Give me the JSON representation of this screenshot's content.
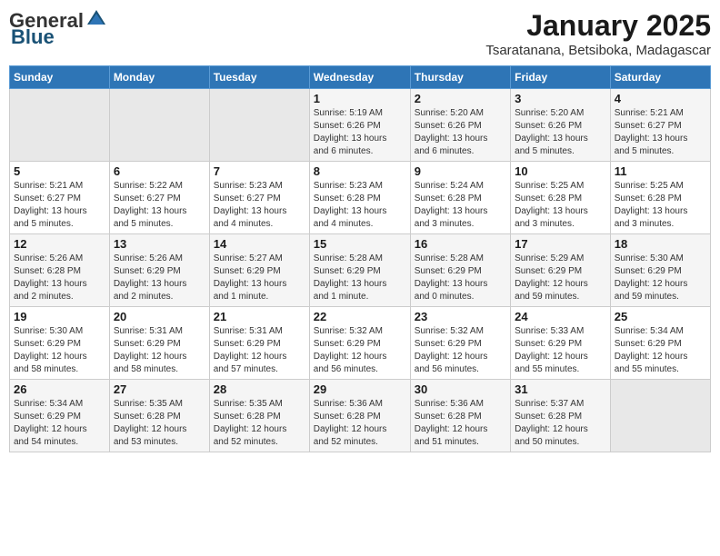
{
  "header": {
    "logo_general": "General",
    "logo_blue": "Blue",
    "month_title": "January 2025",
    "location": "Tsaratanana, Betsiboka, Madagascar"
  },
  "days_of_week": [
    "Sunday",
    "Monday",
    "Tuesday",
    "Wednesday",
    "Thursday",
    "Friday",
    "Saturday"
  ],
  "weeks": [
    [
      {
        "day": "",
        "info": ""
      },
      {
        "day": "",
        "info": ""
      },
      {
        "day": "",
        "info": ""
      },
      {
        "day": "1",
        "info": "Sunrise: 5:19 AM\nSunset: 6:26 PM\nDaylight: 13 hours\nand 6 minutes."
      },
      {
        "day": "2",
        "info": "Sunrise: 5:20 AM\nSunset: 6:26 PM\nDaylight: 13 hours\nand 6 minutes."
      },
      {
        "day": "3",
        "info": "Sunrise: 5:20 AM\nSunset: 6:26 PM\nDaylight: 13 hours\nand 5 minutes."
      },
      {
        "day": "4",
        "info": "Sunrise: 5:21 AM\nSunset: 6:27 PM\nDaylight: 13 hours\nand 5 minutes."
      }
    ],
    [
      {
        "day": "5",
        "info": "Sunrise: 5:21 AM\nSunset: 6:27 PM\nDaylight: 13 hours\nand 5 minutes."
      },
      {
        "day": "6",
        "info": "Sunrise: 5:22 AM\nSunset: 6:27 PM\nDaylight: 13 hours\nand 5 minutes."
      },
      {
        "day": "7",
        "info": "Sunrise: 5:23 AM\nSunset: 6:27 PM\nDaylight: 13 hours\nand 4 minutes."
      },
      {
        "day": "8",
        "info": "Sunrise: 5:23 AM\nSunset: 6:28 PM\nDaylight: 13 hours\nand 4 minutes."
      },
      {
        "day": "9",
        "info": "Sunrise: 5:24 AM\nSunset: 6:28 PM\nDaylight: 13 hours\nand 3 minutes."
      },
      {
        "day": "10",
        "info": "Sunrise: 5:25 AM\nSunset: 6:28 PM\nDaylight: 13 hours\nand 3 minutes."
      },
      {
        "day": "11",
        "info": "Sunrise: 5:25 AM\nSunset: 6:28 PM\nDaylight: 13 hours\nand 3 minutes."
      }
    ],
    [
      {
        "day": "12",
        "info": "Sunrise: 5:26 AM\nSunset: 6:28 PM\nDaylight: 13 hours\nand 2 minutes."
      },
      {
        "day": "13",
        "info": "Sunrise: 5:26 AM\nSunset: 6:29 PM\nDaylight: 13 hours\nand 2 minutes."
      },
      {
        "day": "14",
        "info": "Sunrise: 5:27 AM\nSunset: 6:29 PM\nDaylight: 13 hours\nand 1 minute."
      },
      {
        "day": "15",
        "info": "Sunrise: 5:28 AM\nSunset: 6:29 PM\nDaylight: 13 hours\nand 1 minute."
      },
      {
        "day": "16",
        "info": "Sunrise: 5:28 AM\nSunset: 6:29 PM\nDaylight: 13 hours\nand 0 minutes."
      },
      {
        "day": "17",
        "info": "Sunrise: 5:29 AM\nSunset: 6:29 PM\nDaylight: 12 hours\nand 59 minutes."
      },
      {
        "day": "18",
        "info": "Sunrise: 5:30 AM\nSunset: 6:29 PM\nDaylight: 12 hours\nand 59 minutes."
      }
    ],
    [
      {
        "day": "19",
        "info": "Sunrise: 5:30 AM\nSunset: 6:29 PM\nDaylight: 12 hours\nand 58 minutes."
      },
      {
        "day": "20",
        "info": "Sunrise: 5:31 AM\nSunset: 6:29 PM\nDaylight: 12 hours\nand 58 minutes."
      },
      {
        "day": "21",
        "info": "Sunrise: 5:31 AM\nSunset: 6:29 PM\nDaylight: 12 hours\nand 57 minutes."
      },
      {
        "day": "22",
        "info": "Sunrise: 5:32 AM\nSunset: 6:29 PM\nDaylight: 12 hours\nand 56 minutes."
      },
      {
        "day": "23",
        "info": "Sunrise: 5:32 AM\nSunset: 6:29 PM\nDaylight: 12 hours\nand 56 minutes."
      },
      {
        "day": "24",
        "info": "Sunrise: 5:33 AM\nSunset: 6:29 PM\nDaylight: 12 hours\nand 55 minutes."
      },
      {
        "day": "25",
        "info": "Sunrise: 5:34 AM\nSunset: 6:29 PM\nDaylight: 12 hours\nand 55 minutes."
      }
    ],
    [
      {
        "day": "26",
        "info": "Sunrise: 5:34 AM\nSunset: 6:29 PM\nDaylight: 12 hours\nand 54 minutes."
      },
      {
        "day": "27",
        "info": "Sunrise: 5:35 AM\nSunset: 6:28 PM\nDaylight: 12 hours\nand 53 minutes."
      },
      {
        "day": "28",
        "info": "Sunrise: 5:35 AM\nSunset: 6:28 PM\nDaylight: 12 hours\nand 52 minutes."
      },
      {
        "day": "29",
        "info": "Sunrise: 5:36 AM\nSunset: 6:28 PM\nDaylight: 12 hours\nand 52 minutes."
      },
      {
        "day": "30",
        "info": "Sunrise: 5:36 AM\nSunset: 6:28 PM\nDaylight: 12 hours\nand 51 minutes."
      },
      {
        "day": "31",
        "info": "Sunrise: 5:37 AM\nSunset: 6:28 PM\nDaylight: 12 hours\nand 50 minutes."
      },
      {
        "day": "",
        "info": ""
      }
    ]
  ]
}
